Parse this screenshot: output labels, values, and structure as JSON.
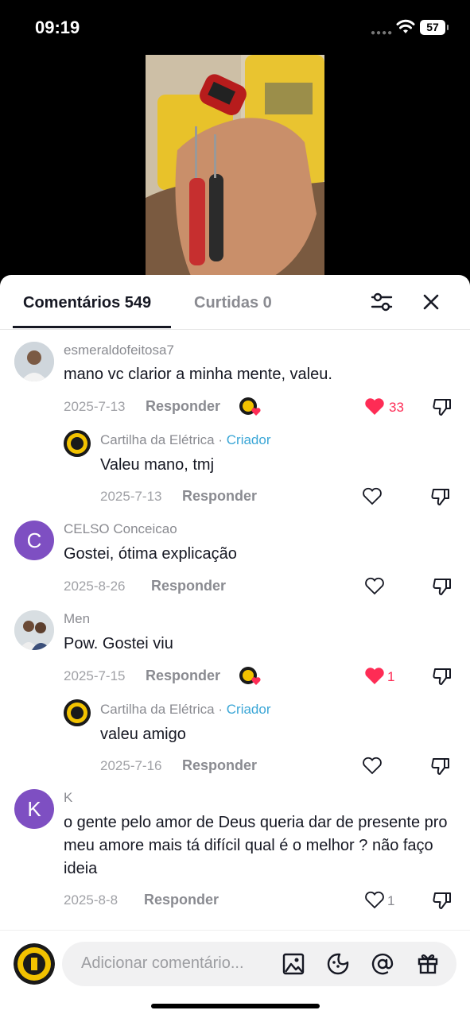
{
  "status_bar": {
    "time": "09:19",
    "battery": "57"
  },
  "tabs": {
    "comments": "Comentários 549",
    "likes": "Curtidas 0"
  },
  "comments": [
    {
      "user": "esmeraldofeitosa7",
      "text": "mano vc clarior a minha mente, valeu.",
      "date": "2025-7-13",
      "reply": "Responder",
      "likes": "33",
      "reply_item": {
        "user": "Cartilha da Elétrica",
        "sep": "·",
        "badge": "Criador",
        "text": "Valeu mano, tmj",
        "date": "2025-7-13",
        "reply": "Responder"
      }
    },
    {
      "user": "CELSO Conceicao",
      "avatar_letter": "C",
      "text": "Gostei, ótima explicação",
      "date": "2025-8-26",
      "reply": "Responder"
    },
    {
      "user": "Men",
      "text": "Pow. Gostei viu",
      "date": "2025-7-15",
      "reply": "Responder",
      "likes": "1",
      "reply_item": {
        "user": "Cartilha da Elétrica",
        "sep": "·",
        "badge": "Criador",
        "text": "valeu amigo",
        "date": "2025-7-16",
        "reply": "Responder"
      }
    },
    {
      "user": "K",
      "avatar_letter": "K",
      "text": "o gente pelo amor de Deus queria dar de presente pro meu amore mais tá difícil qual é o melhor ? não faço ideia",
      "date": "2025-8-8",
      "reply": "Responder",
      "likes": "1"
    }
  ],
  "composer": {
    "placeholder": "Adicionar comentário..."
  },
  "colors": {
    "liked": "#fe2c55",
    "creator": "#3aa6d6",
    "avatar_letter_bg": "#7e4fc2"
  }
}
